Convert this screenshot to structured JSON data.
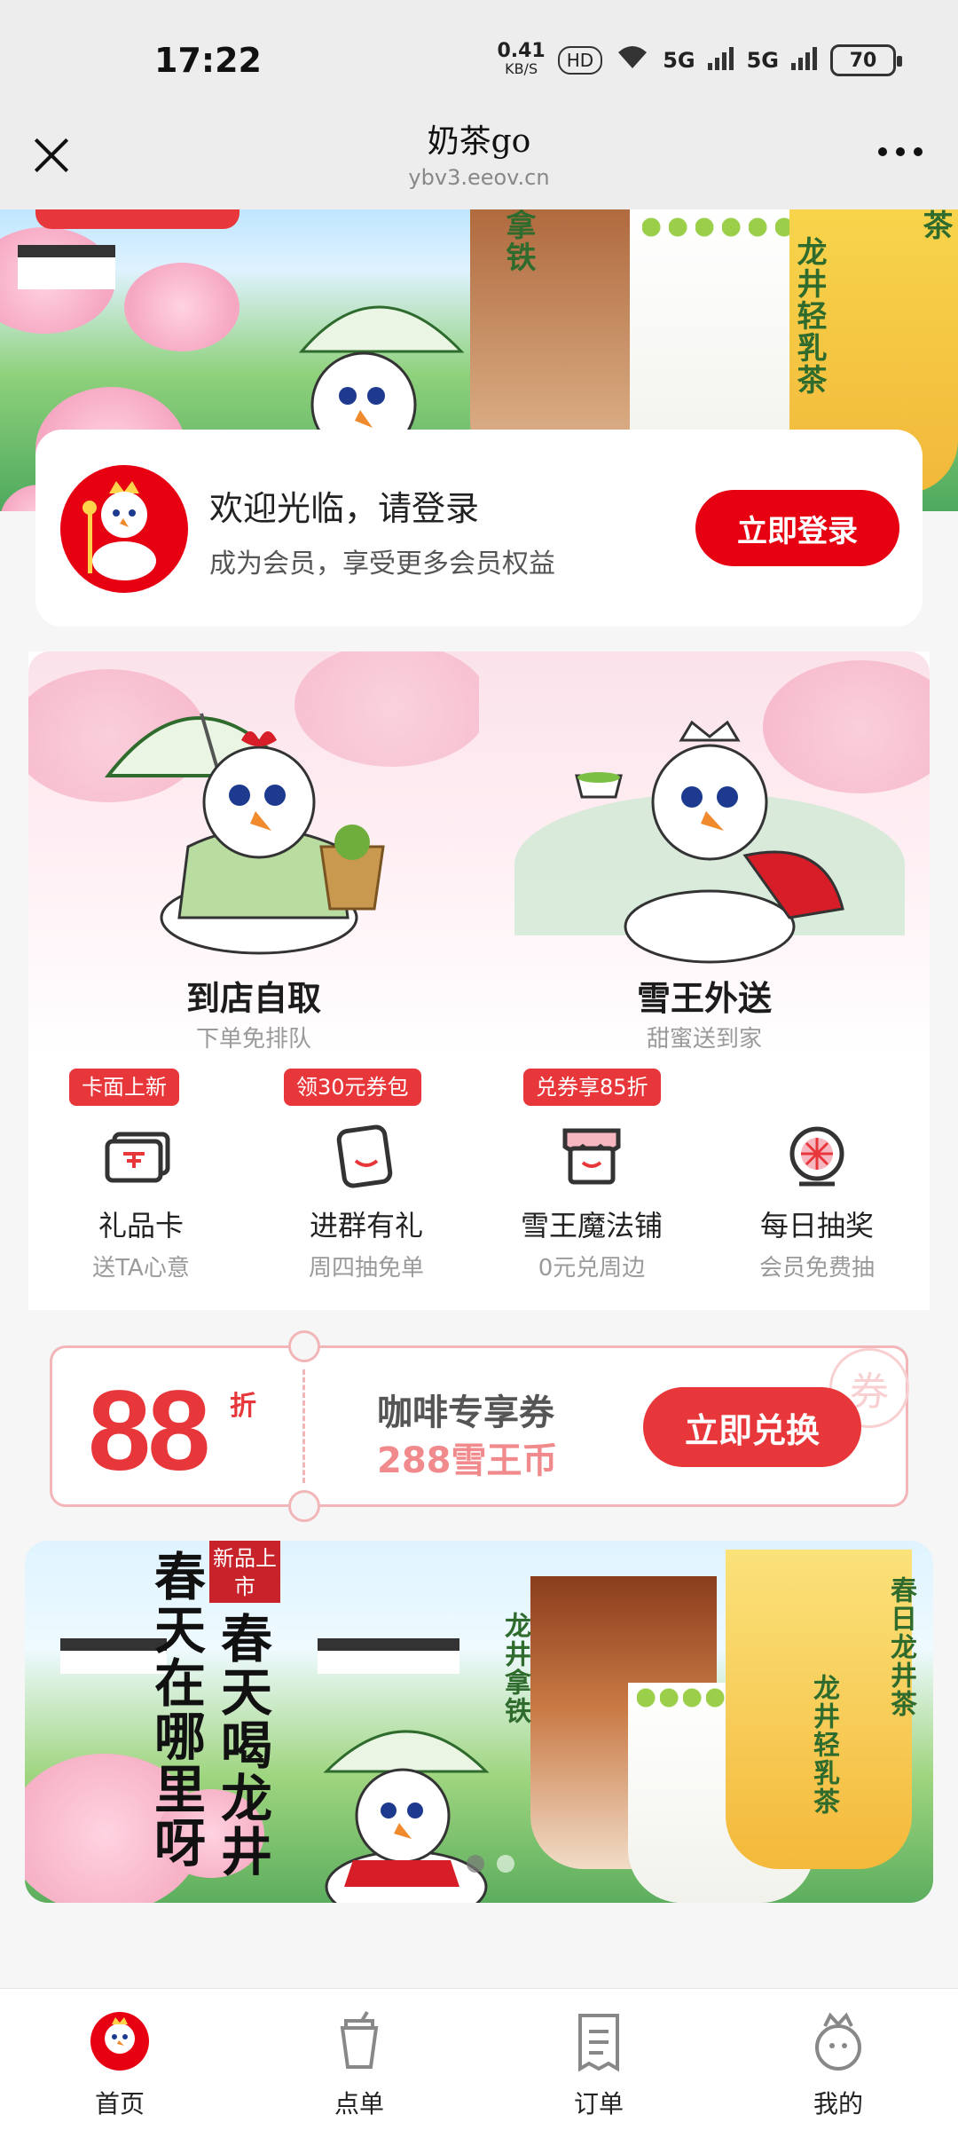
{
  "status_bar": {
    "time": "17:22",
    "net_speed": "0.41",
    "net_unit": "KB/S",
    "network_1": "5G",
    "network_2": "5G",
    "battery": "70"
  },
  "title_bar": {
    "title": "奶茶go",
    "subtitle": "ybv3.eeov.cn"
  },
  "hero": {
    "side_text_1": "拿铁",
    "side_text_2": "龙井轻乳茶",
    "side_text_3": "茶"
  },
  "login_card": {
    "title": "欢迎光临，请登录",
    "subtitle": "成为会员，享受更多会员权益",
    "button": "立即登录"
  },
  "panels": [
    {
      "title": "到店自取",
      "subtitle": "下单免排队"
    },
    {
      "title": "雪王外送",
      "subtitle": "甜蜜送到家"
    }
  ],
  "quick_items": [
    {
      "badge": "卡面上新",
      "label": "礼品卡",
      "sub": "送TA心意",
      "icon": "gift-card-icon"
    },
    {
      "badge": "领30元券包",
      "label": "进群有礼",
      "sub": "周四抽免单",
      "icon": "group-chat-icon"
    },
    {
      "badge": "兑券享85折",
      "label": "雪王魔法铺",
      "sub": "0元兑周边",
      "icon": "shop-icon"
    },
    {
      "badge": "",
      "label": "每日抽奖",
      "sub": "会员免费抽",
      "icon": "lottery-wheel-icon"
    }
  ],
  "coupon": {
    "value": "88",
    "unit": "折",
    "title": "咖啡专享券",
    "price": "288雪王币",
    "button": "立即兑换",
    "stamp": "券"
  },
  "banner": {
    "tag": "新品上市",
    "title_1": "春天在哪里呀",
    "title_2": "春天喝龙井",
    "label_1": "龙井拿铁",
    "label_2": "龙井轻乳茶",
    "label_3": "春日龙井茶"
  },
  "tabbar": [
    {
      "label": "首页",
      "icon": "home-icon",
      "active": true
    },
    {
      "label": "点单",
      "icon": "cup-icon",
      "active": false
    },
    {
      "label": "订单",
      "icon": "order-icon",
      "active": false
    },
    {
      "label": "我的",
      "icon": "profile-icon",
      "active": false
    }
  ],
  "colors": {
    "brand_red": "#e60012",
    "accent_red": "#e8373a",
    "coupon_border": "#f3b6b8"
  }
}
